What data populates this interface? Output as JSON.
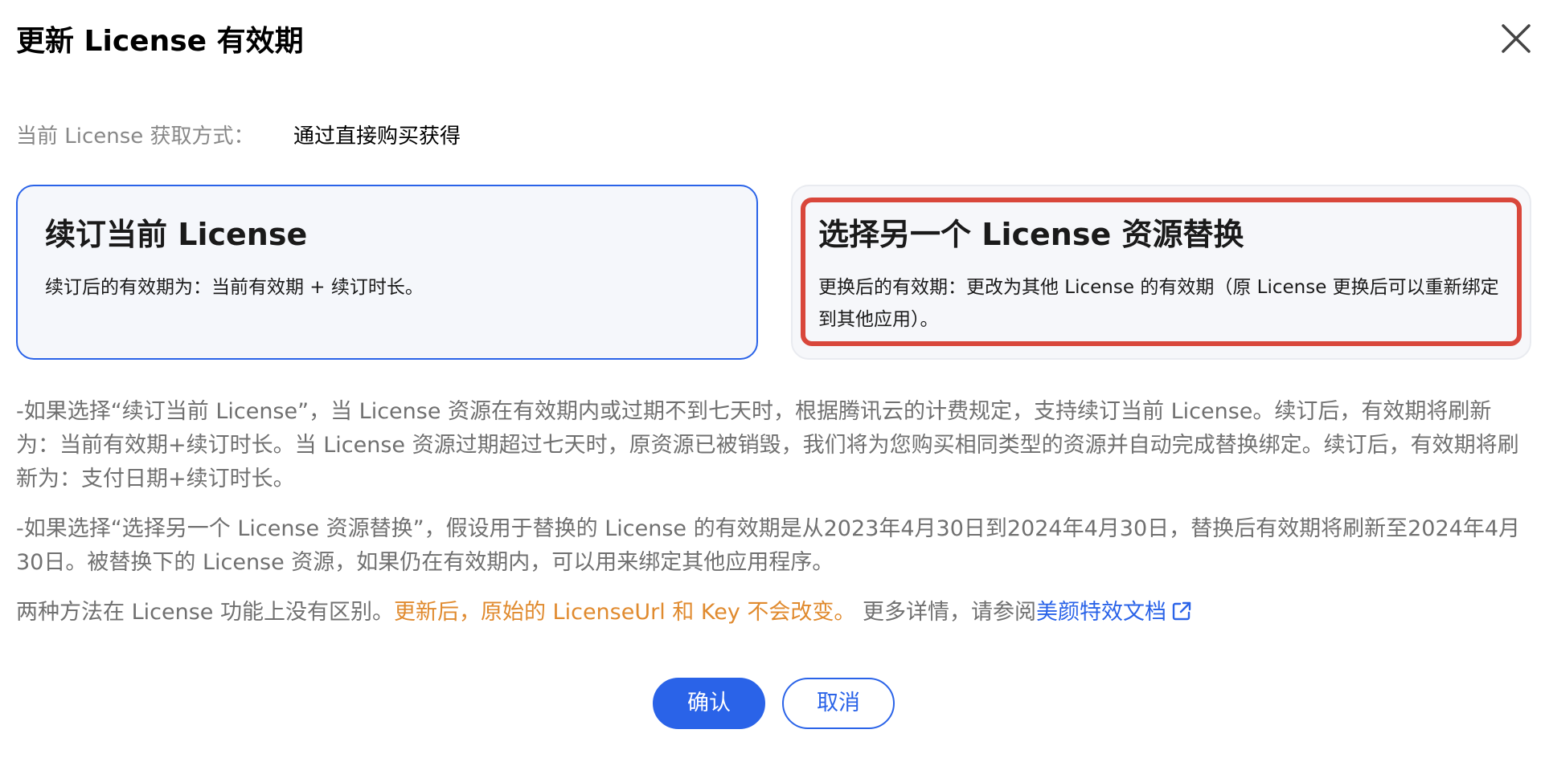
{
  "dialog": {
    "title": "更新 License 有效期",
    "close_icon": "close-icon"
  },
  "source": {
    "label": "当前 License 获取方式：",
    "value": "通过直接购买获得"
  },
  "options": [
    {
      "title": "续订当前 License",
      "description": "续订后的有效期为：当前有效期 + 续订时长。"
    },
    {
      "title": "选择另一个 License 资源替换",
      "description": "更换后的有效期：更改为其他 License 的有效期（原 License 更换后可以重新绑定到其他应用）。"
    }
  ],
  "notes": {
    "note1": "-如果选择“续订当前 License”，当 License 资源在有效期内或过期不到七天时，根据腾讯云的计费规定，支持续订当前 License。续订后，有效期将刷新为：当前有效期+续订时长。当 License 资源过期超过七天时，原资源已被销毁，我们将为您购买相同类型的资源并自动完成替换绑定。续订后，有效期将刷新为：支付日期+续订时长。",
    "note2": "-如果选择“选择另一个 License 资源替换”，假设用于替换的 License 的有效期是从2023年4月30日到2024年4月30日，替换后有效期将刷新至2024年4月30日。被替换下的 License 资源，如果仍在有效期内，可以用来绑定其他应用程序。",
    "note3_prefix": "两种方法在 License 功能上没有区别。",
    "note3_warning": "更新后，原始的 LicenseUrl 和 Key 不会改变。",
    "note3_more": " 更多详情，请参阅",
    "note3_link": "美颜特效文档",
    "link_icon": "external-link-icon"
  },
  "buttons": {
    "confirm": "确认",
    "cancel": "取消"
  },
  "colors": {
    "primary": "#2a63e8",
    "warning": "#e08a2e",
    "highlight": "#d9473b",
    "muted_text": "#707070"
  }
}
